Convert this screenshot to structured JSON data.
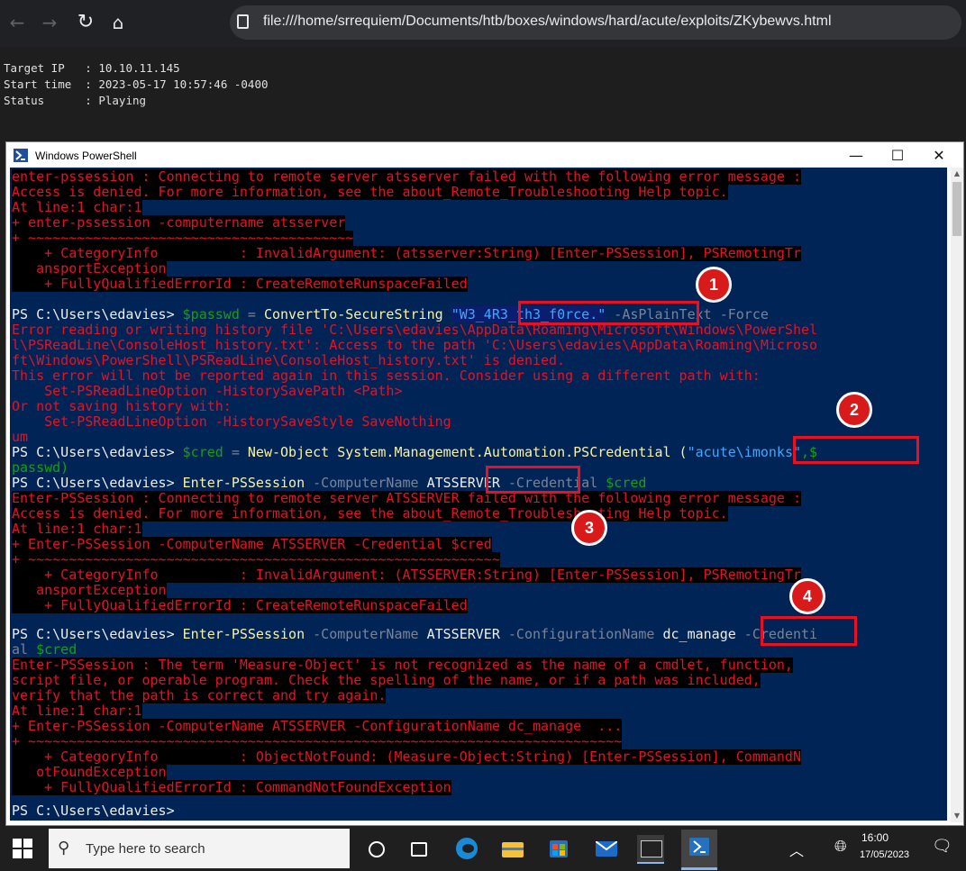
{
  "browser": {
    "url": "file:///home/srrequiem/Documents/htb/boxes/windows/hard/acute/exploits/ZKybewvs.html"
  },
  "terminal": {
    "lines": [
      "Target IP   : 10.10.11.145",
      "Start time  : 2023-05-17 10:57:46 -0400",
      "Status      : Playing"
    ]
  },
  "window": {
    "title": "Windows PowerShell",
    "minimize": "—",
    "maximize": "☐",
    "close": "✕"
  },
  "console": {
    "l1": "enter-pssession : Connecting to remote server atsserver failed with the following error message :",
    "l2": "Access is denied. For more information, see the about_Remote_Troubleshooting Help topic.",
    "l3": "At line:1 char:1",
    "l4": "+ enter-pssession -computername atsserver",
    "l5": "+ ~~~~~~~~~~~~~~~~~~~~~~~~~~~~~~~~~~~~~~~~",
    "l6": "    + CategoryInfo          : InvalidArgument: (atsserver:String) [Enter-PSSession], PSRemotingTr",
    "l7": "   ansportException",
    "l8": "    + FullyQualifiedErrorId : CreateRemoteRunspaceFailed",
    "l9_prompt": "PS C:\\Users\\edavies> ",
    "l9_var": "$passwd",
    "l9_eq": " = ",
    "l9_cmd": "ConvertTo-SecureString ",
    "l9_str": "\"W3_4R3_th3_f0rce.\"",
    "l9_params": " -AsPlainText -Force",
    "l10": "Error reading or writing history file 'C:\\Users\\edavies\\AppData\\Roaming\\Microsoft\\Windows\\PowerShel",
    "l11": "l\\PSReadLine\\ConsoleHost_history.txt': Access to the path 'C:\\Users\\edavies\\AppData\\Roaming\\Microso",
    "l12": "ft\\Windows\\PowerShell\\PSReadLine\\ConsoleHost_history.txt' is denied.",
    "l13": "This error will not be reported again in this session. Consider using a different path with:",
    "l14": "    Set-PSReadLineOption -HistorySavePath <Path>",
    "l15": "Or not saving history with:",
    "l16": "    Set-PSReadLineOption -HistorySaveStyle SaveNothing",
    "l17": "um",
    "l18_prompt": "PS C:\\Users\\edavies> ",
    "l18_var": "$cred",
    "l18_eq": " = ",
    "l18_cmd": "New-Object System.Management.Automation.PSCredential (",
    "l18_str": "\"acute\\imonks\"",
    "l18_tail": ",$",
    "l19": "passwd)",
    "l20_prompt": "PS C:\\Users\\edavies> ",
    "l20_cmd": "Enter-PSSession ",
    "l20_p1": "-ComputerName ",
    "l20_v1": "ATSSERVER",
    "l20_p2": " -Credential ",
    "l20_v2": "$cred",
    "l21": "Enter-PSSession : Connecting to remote server ATSSERVER failed with the following error message :",
    "l22": "Access is denied. For more information, see the about_Remote_Troubleshooting Help topic.",
    "l23": "At line:1 char:1",
    "l24": "+ Enter-PSSession -ComputerName ATSSERVER -Credential $cred",
    "l25": "+ ~~~~~~~~~~~~~~~~~~~~~~~~~~~~~~~~~~~~~~~~~~~~~~~~~~~~~~~~~~",
    "l26": "    + CategoryInfo          : InvalidArgument: (ATSSERVER:String) [Enter-PSSession], PSRemotingTr",
    "l27": "   ansportException",
    "l28": "    + FullyQualifiedErrorId : CreateRemoteRunspaceFailed",
    "l29_prompt": "PS C:\\Users\\edavies> ",
    "l29_cmd": "Enter-PSSession ",
    "l29_p1": "-ComputerName ",
    "l29_v1": "ATSSERVER ",
    "l29_p2": "-ConfigurationName ",
    "l29_v2": "dc_manage",
    "l29_p3": " -Credenti",
    "l30_p": "al ",
    "l30_v": "$cred",
    "l31": "Enter-PSSession : The term 'Measure-Object' is not recognized as the name of a cmdlet, function,",
    "l32": "script file, or operable program. Check the spelling of the name, or if a path was included,",
    "l33": "verify that the path is correct and try again.",
    "l34": "At line:1 char:1",
    "l35": "+ Enter-PSSession -ComputerName ATSSERVER -ConfigurationName dc_manage  ...",
    "l36": "+ ~~~~~~~~~~~~~~~~~~~~~~~~~~~~~~~~~~~~~~~~~~~~~~~~~~~~~~~~~~~~~~~~~~~~~~~~~",
    "l37": "    + CategoryInfo          : ObjectNotFound: (Measure-Object:String) [Enter-PSSession], CommandN",
    "l38": "   otFoundException",
    "l39": "    + FullyQualifiedErrorId : CommandNotFoundException",
    "l40": "PS C:\\Users\\edavies>"
  },
  "annotations": [
    "1",
    "2",
    "3",
    "4"
  ],
  "taskbar": {
    "search_placeholder": "Type here to search",
    "time": "16:00",
    "date": "17/05/2023"
  },
  "colors": {
    "ps_background": "#012456",
    "error_red": "#e81123",
    "string_cyan": "#3ea8ff",
    "variable_green": "#13a10e",
    "annotation_red": "#d91a1a"
  }
}
